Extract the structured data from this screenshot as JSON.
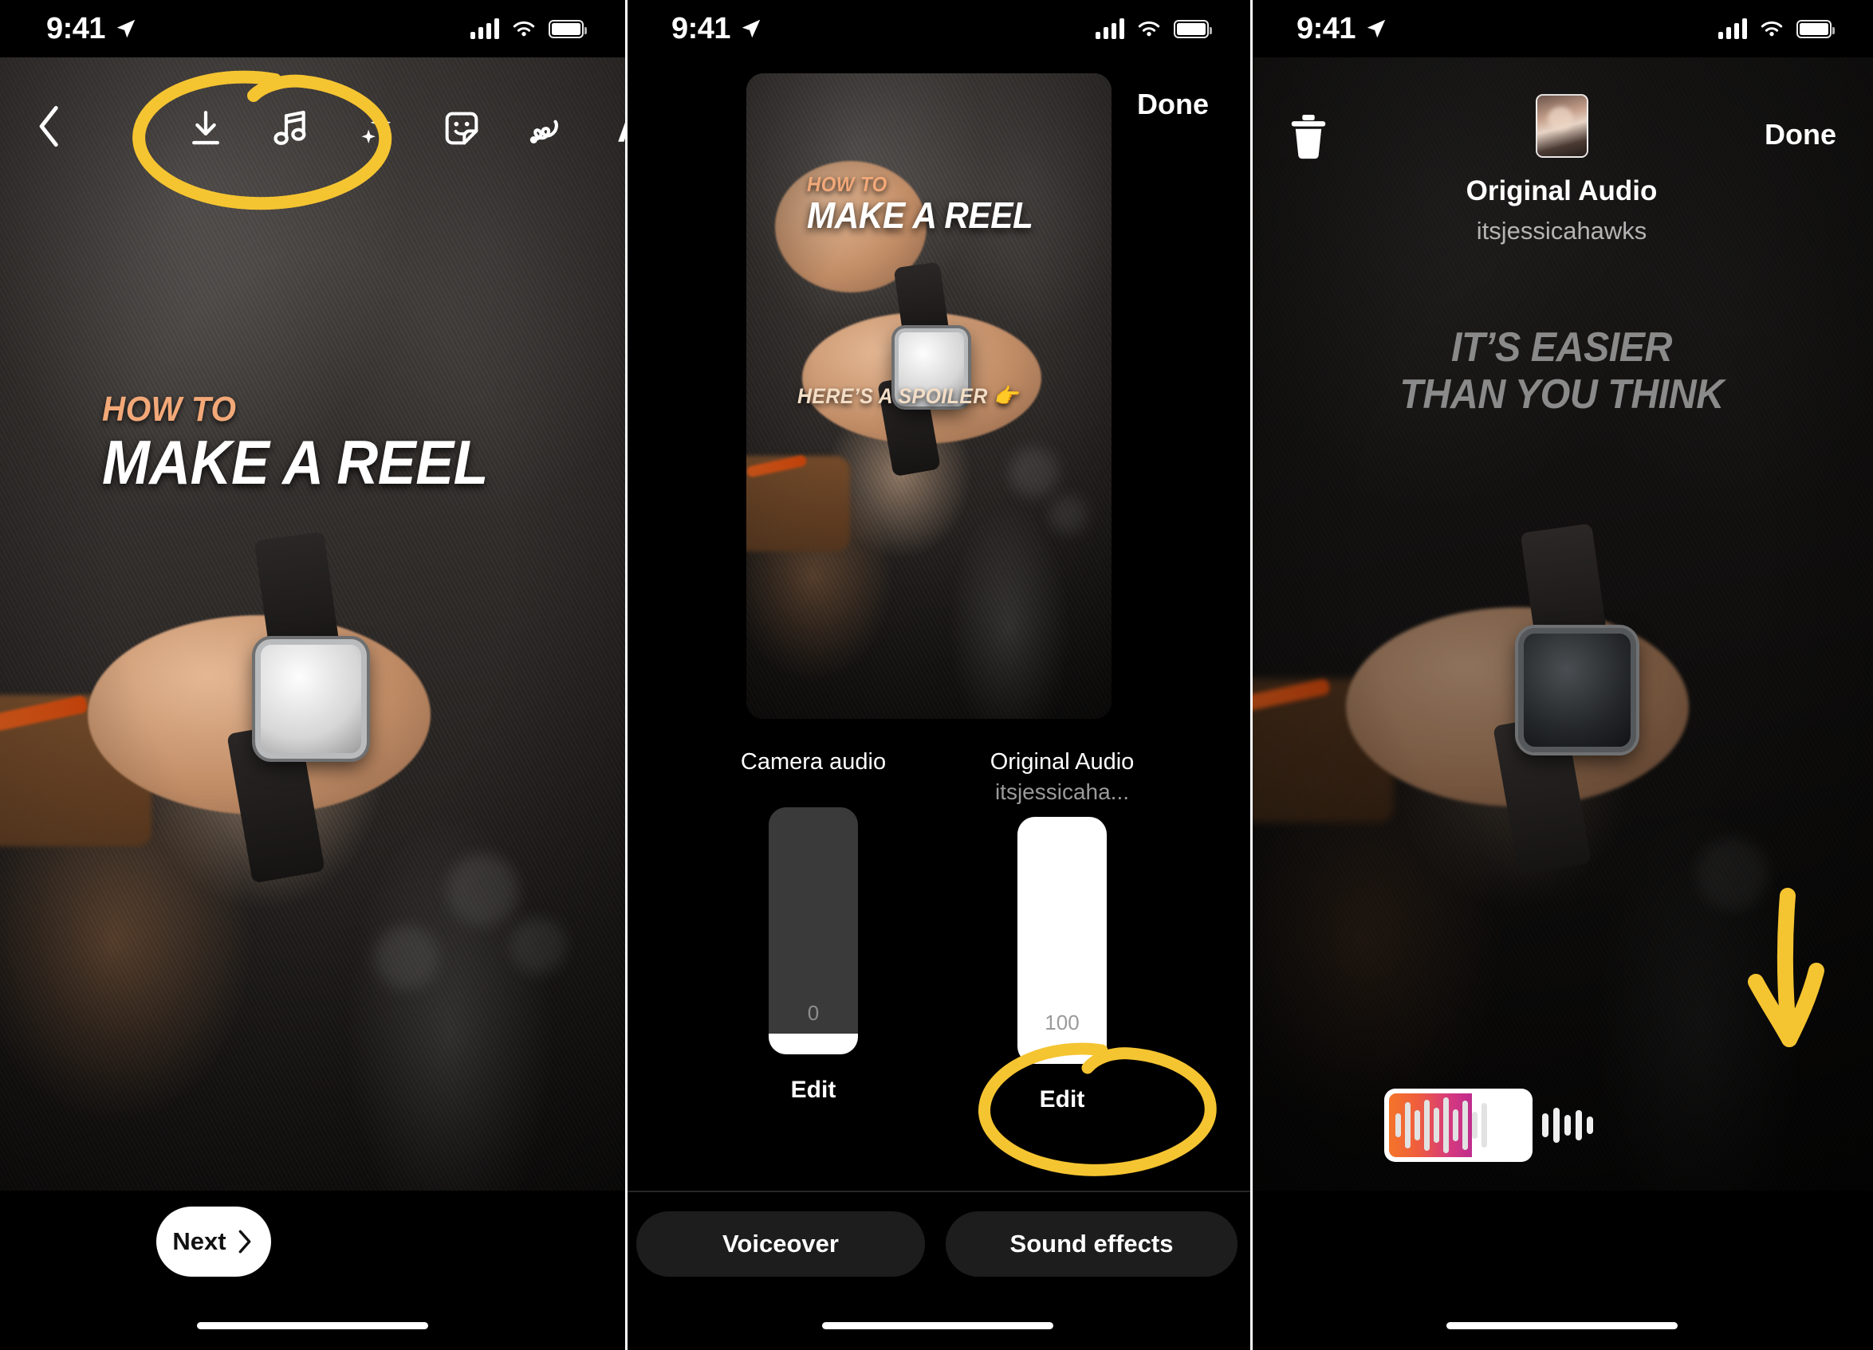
{
  "status_bar": {
    "time": "9:41",
    "location_icon": "location-arrow-icon",
    "cellular_icon": "cellular-bars-icon",
    "wifi_icon": "wifi-icon",
    "battery_icon": "battery-icon"
  },
  "colors": {
    "annotation_yellow": "#F5C431",
    "caption_orange": "#F2A878",
    "caption_white": "#FFFFFF",
    "caption_gray": "#8A8A8A",
    "waveform_gradient_start": "#F4742A",
    "waveform_gradient_end": "#C02C8E",
    "background": "#000000",
    "pill_background": "#1D1D1D"
  },
  "panel1": {
    "back_icon": "chevron-left-icon",
    "toolbar": [
      {
        "name": "download-icon",
        "label": "Download"
      },
      {
        "name": "music-note-icon",
        "label": "Audio"
      },
      {
        "name": "sparkles-icon",
        "label": "Effects"
      },
      {
        "name": "sticker-icon",
        "label": "Stickers"
      },
      {
        "name": "draw-squiggle-icon",
        "label": "Draw"
      },
      {
        "name": "text-aa-icon",
        "label": "Aa"
      }
    ],
    "caption": {
      "line1": "HOW TO",
      "line2": "MAKE A REEL"
    },
    "annotation": "yellow-circle-around-music-icon",
    "next_button": {
      "label": "Next",
      "icon": "chevron-right-icon"
    }
  },
  "panel2": {
    "done_label": "Done",
    "preview_caption": {
      "line1": "HOW TO",
      "line2": "MAKE A REEL"
    },
    "preview_spoiler": "HERE’S A SPOILER 👉",
    "tracks": [
      {
        "title": "Camera audio",
        "subtitle": "",
        "value": "0",
        "volume": 0,
        "edit_label": "Edit"
      },
      {
        "title": "Original Audio",
        "subtitle": "itsjessicaha...",
        "value": "100",
        "volume": 100,
        "edit_label": "Edit"
      }
    ],
    "annotation": "yellow-circle-around-original-audio-edit",
    "bottom_buttons": [
      {
        "label": "Voiceover"
      },
      {
        "label": "Sound effects"
      }
    ]
  },
  "panel3": {
    "trash_icon": "trash-icon",
    "done_label": "Done",
    "avatar": "audio-owner-avatar",
    "audio_title": "Original Audio",
    "audio_author": "itsjessicahawks",
    "caption": {
      "line1": "IT’S EASIER",
      "line2": "THAN YOU THINK"
    },
    "annotation": "yellow-down-arrow-to-waveform",
    "waveform": {
      "name": "audio-trim-waveform",
      "selection_bars": [
        30,
        58,
        38,
        64,
        44,
        70,
        40,
        62,
        34,
        56
      ],
      "tail_bars": [
        30,
        44,
        26,
        38,
        22
      ],
      "selection_fill_pct": 60
    }
  }
}
